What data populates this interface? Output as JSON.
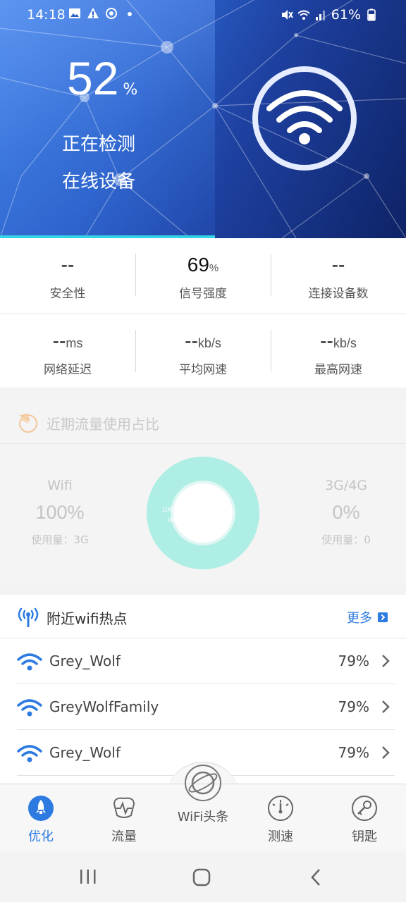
{
  "status_bar": {
    "time": "14:18",
    "battery": "61%",
    "left_icons": [
      "image-icon",
      "alert-icon",
      "sync-icon",
      "dot-icon"
    ],
    "right_icons": [
      "mute-icon",
      "wifi-icon",
      "signal-icon",
      "battery-icon"
    ]
  },
  "hero": {
    "progress_value": "52",
    "progress_unit": "%",
    "progress_fraction": 0.52,
    "line1": "正在检测",
    "line2": "在线设备",
    "icon": "wifi-icon"
  },
  "stats_top": [
    {
      "value": "--",
      "unit": "",
      "label": "安全性"
    },
    {
      "value": "69",
      "unit": "%",
      "label": "信号强度"
    },
    {
      "value": "--",
      "unit": "",
      "label": "连接设备数"
    }
  ],
  "stats_bottom": [
    {
      "value": "--",
      "unit": "ms",
      "label": "网络延迟"
    },
    {
      "value": "--",
      "unit": "kb/s",
      "label": "平均网速"
    },
    {
      "value": "--",
      "unit": "kb/s",
      "label": "最高网速"
    }
  ],
  "traffic": {
    "title": "近期流量使用占比",
    "wifi": {
      "name": "Wifi",
      "percent": "100%",
      "usage": "使用量：3G"
    },
    "cellular": {
      "name": "3G/4G",
      "percent": "0%",
      "usage": "使用量：0"
    },
    "donut_label_pct": "100.0 %",
    "donut_label_name": "WiFi"
  },
  "chart_data": {
    "type": "pie",
    "categories": [
      "WiFi",
      "3G/4G"
    ],
    "values": [
      100,
      0
    ]
  },
  "hotspots": {
    "title": "附近wifi热点",
    "more_label": "更多",
    "items": [
      {
        "ssid": "Grey_Wolf",
        "signal": "79%"
      },
      {
        "ssid": "GreyWolfFamily",
        "signal": "79%"
      },
      {
        "ssid": "Grey_Wolf",
        "signal": "79%"
      }
    ]
  },
  "nav": {
    "items": [
      {
        "label": "优化",
        "icon": "rocket-icon",
        "active": true
      },
      {
        "label": "流量",
        "icon": "pulse-icon",
        "active": false
      },
      {
        "label": "WiFi头条",
        "icon": "planet-icon",
        "active": false
      },
      {
        "label": "测速",
        "icon": "speedometer-icon",
        "active": false
      },
      {
        "label": "钥匙",
        "icon": "key-icon",
        "active": false
      }
    ]
  },
  "colors": {
    "accent": "#2d7be0",
    "donut": "#aeeee4",
    "progress": "#34d4e6"
  }
}
